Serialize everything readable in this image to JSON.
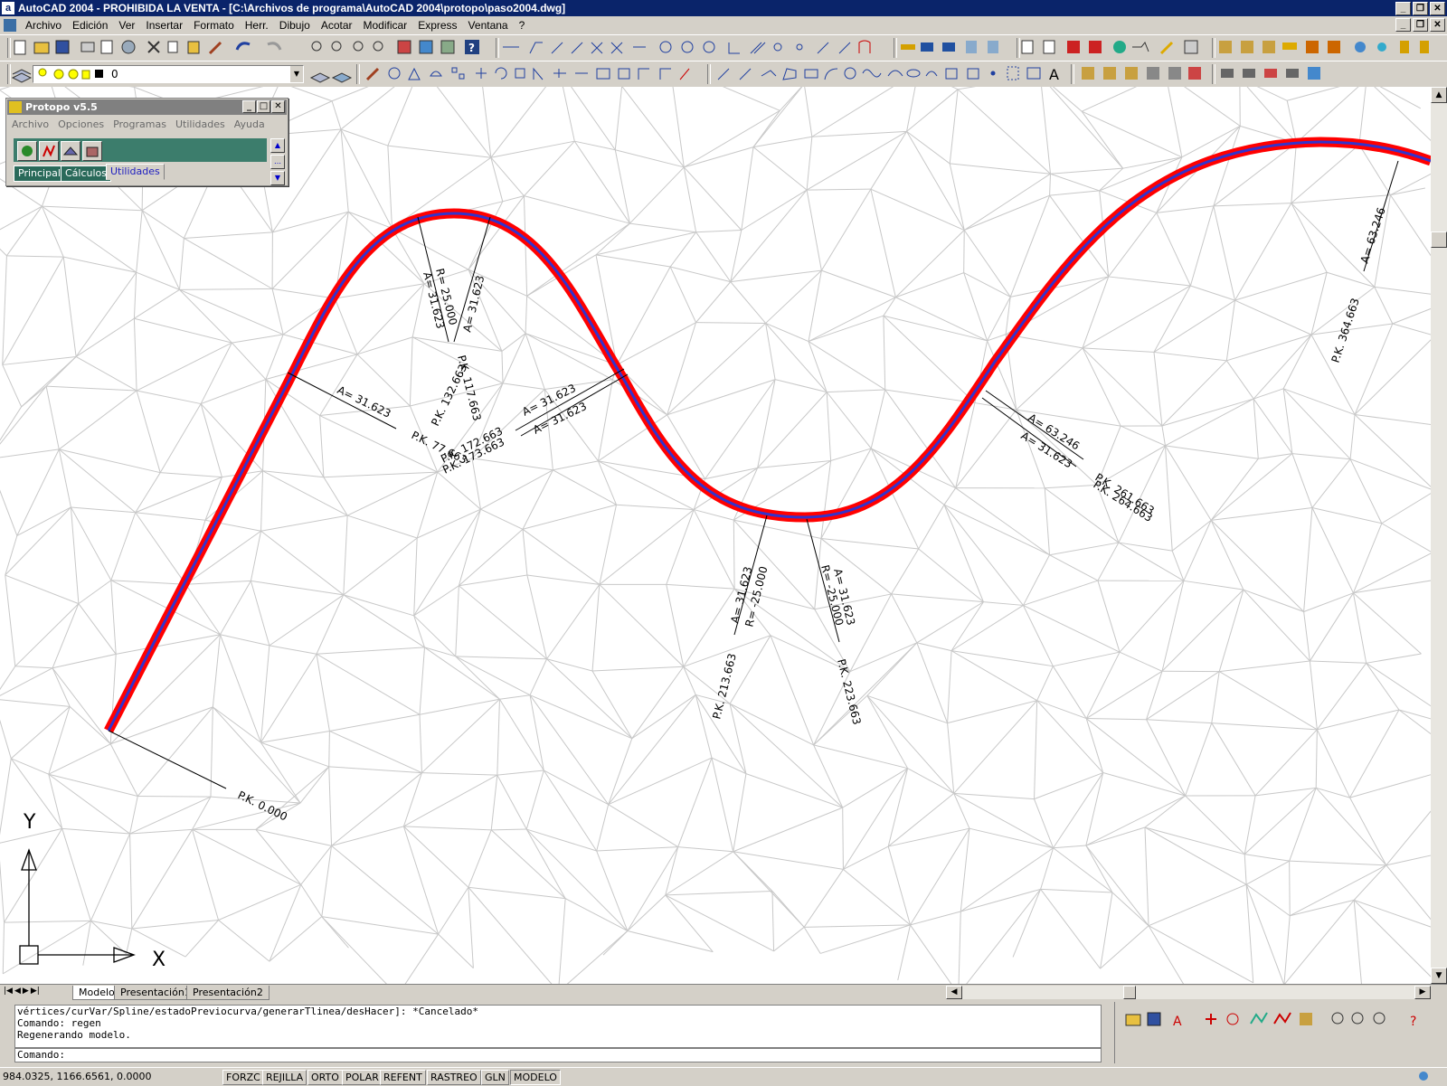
{
  "window": {
    "title": "AutoCAD 2004 - PROHIBIDA LA VENTA - [C:\\Archivos de programa\\AutoCAD 2004\\protopo\\paso2004.dwg]",
    "app_icon": "a"
  },
  "menu": [
    "Archivo",
    "Edición",
    "Ver",
    "Insertar",
    "Formato",
    "Herr.",
    "Dibujo",
    "Acotar",
    "Modificar",
    "Express",
    "Ventana",
    "?"
  ],
  "layer": {
    "current": "0"
  },
  "protopo": {
    "title": "Protopo v5.5",
    "menu": [
      "Archivo",
      "Opciones",
      "Programas",
      "Utilidades",
      "Ayuda"
    ],
    "tabs": [
      "Principal",
      "Cálculos",
      "Utilidades"
    ],
    "active_tab": "Utilidades",
    "tool_icons": [
      "terrain-icon",
      "profile-icon",
      "section-icon",
      "volume-icon"
    ]
  },
  "drawing": {
    "alignment_color": "#ff0000",
    "axis_color": "#3333cc",
    "tin_color": "#c8c8c8",
    "labels": {
      "pk_0": "P.K. 0.000",
      "a_31623_a": "A= 31.623",
      "pk_77": "P.K. 77.663",
      "pk_117": "P.K. 117.663",
      "pk_132": "P.K. 132.663",
      "pk_172": "P.K. 172.663",
      "pk_173": "P.K. 173.663",
      "r_25": "R= 25.000",
      "a_31623_b": "A= 31.623",
      "a_31623_c": "A= 31.623",
      "a_31623_d": "A= 31.623",
      "a_31623_e": "A= 31.623",
      "pk_213": "P.K. 213.663",
      "pk_223": "P.K. 223.663",
      "r_m25_a": "R= -25.000",
      "r_m25_b": "R= -25.000",
      "a_31623_f": "A= 31.623",
      "a_31623_g": "A= 31.623",
      "a_63246_a": "A= 63.246",
      "a_31623_h": "A= 31.623",
      "pk_261": "P.K. 261.663",
      "pk_264": "P.K. 264.663",
      "a_63246_b": "A= 63.246",
      "pk_364": "P.K. 364.663"
    },
    "ucs": {
      "x": "X",
      "y": "Y"
    }
  },
  "layout_tabs": [
    "Modelo",
    "Presentación1",
    "Presentación2"
  ],
  "active_layout": "Modelo",
  "command": {
    "history": [
      "vértices/curVar/Spline/estadoPreviocurva/generarTlinea/desHacer]: *Cancelado*",
      "Comando: regen",
      "Regenerando modelo."
    ],
    "prompt": "Comando:"
  },
  "status": {
    "coords": "984.0325, 1166.6561, 0.0000",
    "toggles": [
      "FORZC",
      "REJILLA",
      "ORTO",
      "POLAR",
      "REFENT",
      "RASTREO",
      "GLN",
      "MODELO"
    ],
    "active_toggle": "MODELO"
  }
}
